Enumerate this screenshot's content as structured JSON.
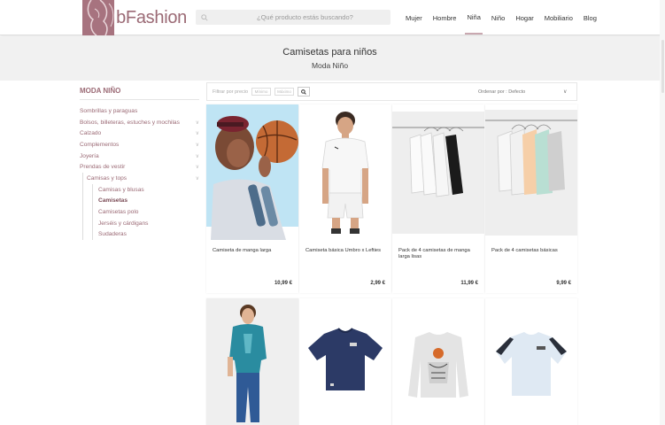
{
  "header": {
    "logo_text": "bFashion",
    "search_placeholder": "¿Qué producto estás buscando?",
    "nav": [
      "Mujer",
      "Hombre",
      "Niña",
      "Niño",
      "Hogar",
      "Mobiliario",
      "Blog"
    ],
    "nav_active": "Niña"
  },
  "banner": {
    "title": "Camisetas para niños",
    "subtitle": "Moda Niño"
  },
  "sidebar": {
    "title": "MODA NIÑO",
    "items": [
      {
        "label": "Sombrillas y paraguas",
        "expandable": false
      },
      {
        "label": "Bolsos, billeteras, estuches y mochilas",
        "expandable": true
      },
      {
        "label": "Calzado",
        "expandable": true
      },
      {
        "label": "Complementos",
        "expandable": true
      },
      {
        "label": "Joyería",
        "expandable": true
      },
      {
        "label": "Prendas de vestir",
        "expandable": true
      }
    ],
    "sub_parent": "Camisas y tops",
    "sub_items": [
      "Camisas y blusas",
      "Camisetas",
      "Camisetas polo",
      "Jerséis y cárdigans",
      "Sudaderas"
    ],
    "current": "Camisetas"
  },
  "toolbar": {
    "filter_label": "Filtrar por precio",
    "min_placeholder": "Mínimo",
    "max_placeholder": "Máximo",
    "sort_label": "Ordenar por : Defecto"
  },
  "products": [
    {
      "name": "Camiseta de manga larga",
      "price": "10,99 €"
    },
    {
      "name": "Camiseta básica Umbro x Lefties",
      "price": "2,99 €"
    },
    {
      "name": "Pack de 4 camisetas de manga larga lisas",
      "price": "11,99 €"
    },
    {
      "name": "Pack de 4 camisetas básicas",
      "price": "9,99 €"
    }
  ],
  "colors": {
    "brand": "#9b6a75",
    "banner_bg": "#f1f1f1"
  }
}
